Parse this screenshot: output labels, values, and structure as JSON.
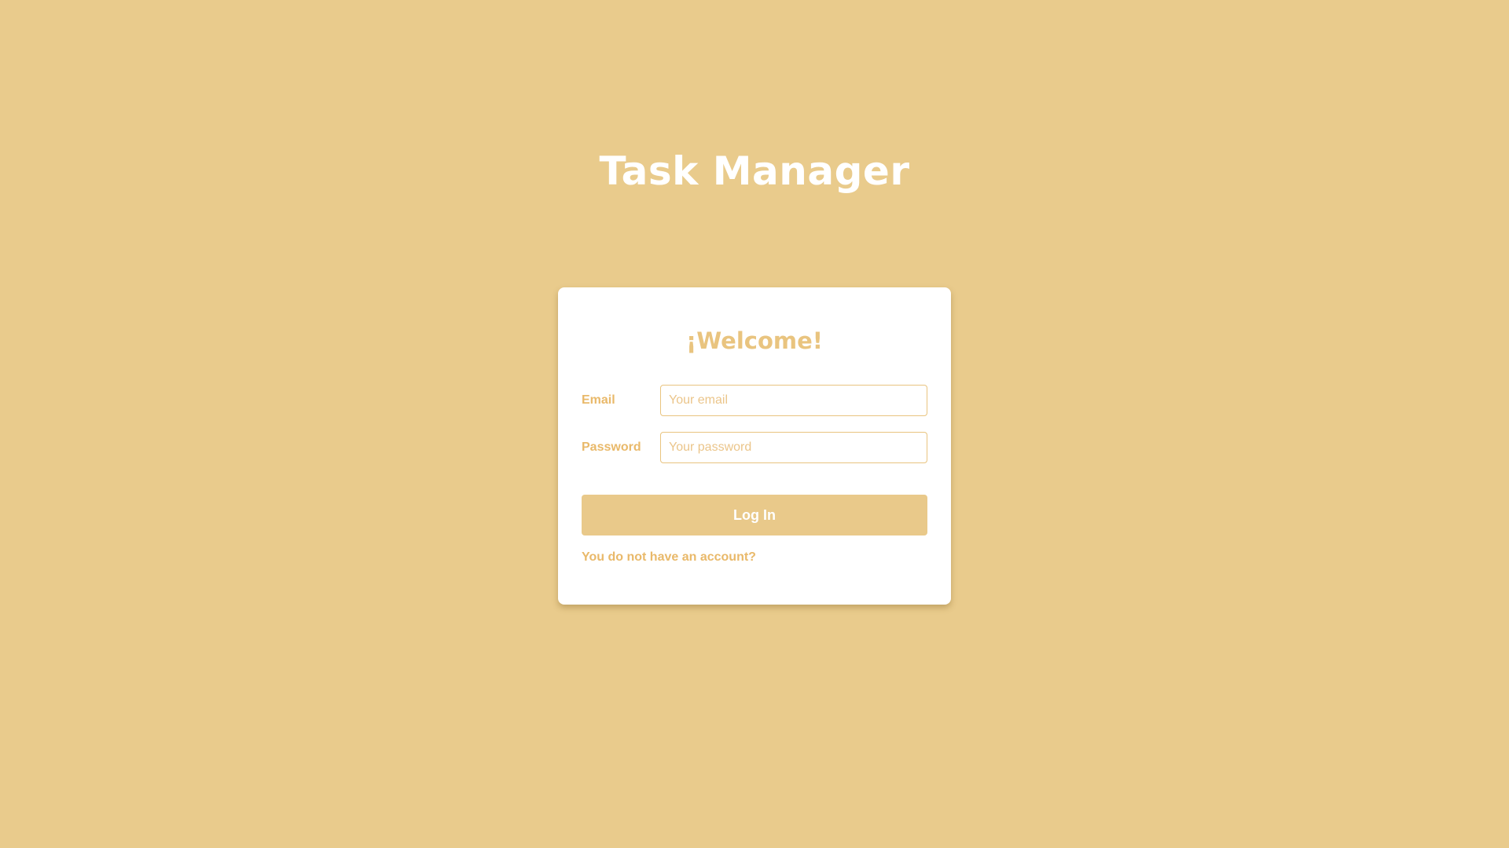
{
  "app": {
    "title": "Task Manager"
  },
  "login_card": {
    "heading": "¡Welcome!",
    "email": {
      "label": "Email",
      "placeholder": "Your email",
      "value": ""
    },
    "password": {
      "label": "Password",
      "placeholder": "Your password",
      "value": ""
    },
    "login_button_label": "Log In",
    "signup_link_text": "You do not have an account?"
  },
  "colors": {
    "background": "#e9cb8c",
    "accent": "#e9b96a",
    "card": "#ffffff",
    "title_text": "#ffffff"
  }
}
